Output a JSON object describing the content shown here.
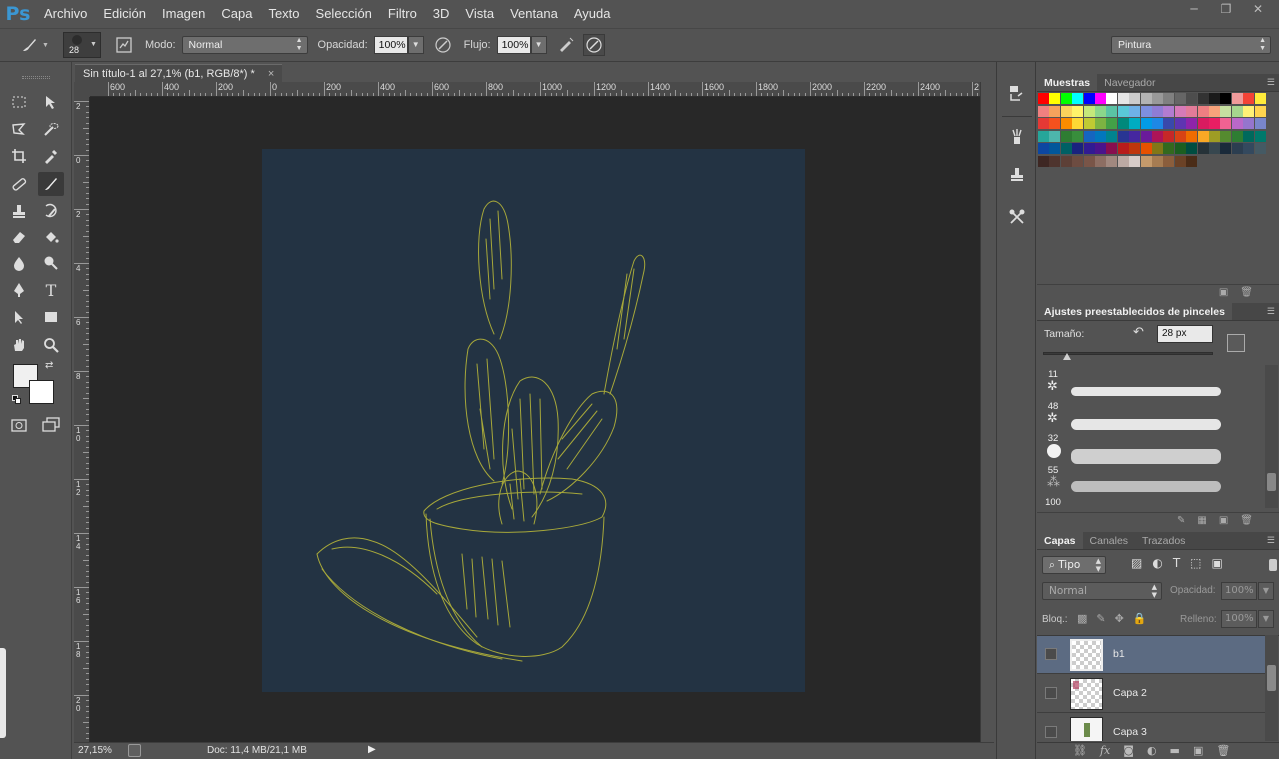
{
  "app": {
    "logo": "Ps"
  },
  "menu": [
    "Archivo",
    "Edición",
    "Imagen",
    "Capa",
    "Texto",
    "Selección",
    "Filtro",
    "3D",
    "Vista",
    "Ventana",
    "Ayuda"
  ],
  "window_controls": [
    "─",
    "❐",
    "✕"
  ],
  "options": {
    "brush_size": "28",
    "mode_label": "Modo:",
    "mode_value": "Normal",
    "opacity_label": "Opacidad:",
    "opacity_value": "100%",
    "flow_label": "Flujo:",
    "flow_value": "100%",
    "workspace_value": "Pintura"
  },
  "document": {
    "tab_title": "Sin título-1 al 27,1% (b1, RGB/8*) *",
    "close": "×",
    "ruler_top": [
      "600",
      "400",
      "200",
      "0",
      "200",
      "400",
      "600",
      "800",
      "1000",
      "1200",
      "1400",
      "1600",
      "1800",
      "2000",
      "2200",
      "2400",
      "2"
    ],
    "ruler_left": [
      "2",
      "0",
      "2",
      "4",
      "6",
      "8",
      "1 0",
      "1 2",
      "1 4",
      "1 6",
      "1 8",
      "2 0"
    ],
    "canvas_color": "#233343",
    "sketch_color": "#a7a83a"
  },
  "status": {
    "zoom": "27,15%",
    "doc_info": "Doc: 11,4 MB/21,1 MB"
  },
  "panels": {
    "swatch_tabs": [
      "Muestras",
      "Navegador"
    ],
    "brush_presets_title": "Ajustes preestablecidos de pinceles",
    "size_label": "Tamaño:",
    "size_value": "28 px",
    "brush_sizes": [
      "11",
      "48",
      "32",
      "55",
      "100"
    ],
    "layer_tabs": [
      "Capas",
      "Canales",
      "Trazados"
    ],
    "filter_kind": "Tipo",
    "blend_mode": "Normal",
    "opacity_label": "Opacidad:",
    "opacity_value": "100%",
    "lock_label": "Bloq.:",
    "fill_label": "Relleno:",
    "fill_value": "100%",
    "layers": [
      "b1",
      "Capa 2",
      "Capa 3"
    ]
  },
  "swatches": [
    [
      "#ff0000",
      "#ffff00",
      "#00ff00",
      "#00ffff",
      "#0000ff",
      "#ff00ff",
      "#ffffff",
      "#e6e6e6",
      "#cccccc",
      "#b3b3b3",
      "#999999",
      "#808080",
      "#666666",
      "#4d4d4d",
      "#333333",
      "#1a1a1a",
      "#000000",
      "#ef9a9a",
      "#f44336",
      "#ffeb3b"
    ],
    [
      "#f08080",
      "#f5a25d",
      "#fbd35c",
      "#fff36a",
      "#c5e87a",
      "#8bd68b",
      "#5ac3a4",
      "#5ac8d8",
      "#6fb1e8",
      "#7d8fe0",
      "#8f7cd5",
      "#b27cd1",
      "#d67ab8",
      "#e27b99",
      "#ee7f82",
      "#f7a37b",
      "#c6e0a0",
      "#a6d68e",
      "#fff176",
      "#ffd54f"
    ],
    [
      "#e53935",
      "#f4511e",
      "#fb8c00",
      "#fdd835",
      "#c0ca33",
      "#7cb342",
      "#43a047",
      "#00897b",
      "#00acc1",
      "#039be5",
      "#1e88e5",
      "#3949ab",
      "#5e35b1",
      "#8e24aa",
      "#d81b60",
      "#e91e63",
      "#f06292",
      "#ba68c8",
      "#9575cd",
      "#7986cb"
    ],
    [
      "#26a69a",
      "#4db6ac",
      "#2e7d32",
      "#388e3c",
      "#1565c0",
      "#0277bd",
      "#00838f",
      "#283593",
      "#4527a0",
      "#6a1b9a",
      "#ad1457",
      "#c62828",
      "#d84315",
      "#ef6c00",
      "#f9a825",
      "#9e9d24",
      "#558b2f",
      "#2e7d32",
      "#00695c",
      "#00796b"
    ],
    [
      "#0d47a1",
      "#01579b",
      "#006064",
      "#1a237e",
      "#311b92",
      "#4a148c",
      "#880e4f",
      "#b71c1c",
      "#bf360c",
      "#e65100",
      "#827717",
      "#33691e",
      "#1b5e20",
      "#004d40",
      "#263238",
      "#37474f",
      "#1a2a3a",
      "#2c3e50",
      "#34495e",
      "#455a64"
    ],
    [
      "#3e2723",
      "#4e342e",
      "#5d4037",
      "#6d4c41",
      "#795548",
      "#8d6e63",
      "#a1887f",
      "#bcaaa4",
      "#d7ccc8",
      "#c49a6c",
      "#a67c52",
      "#8b5e3c",
      "#6b4226",
      "#4a2c17"
    ]
  ]
}
